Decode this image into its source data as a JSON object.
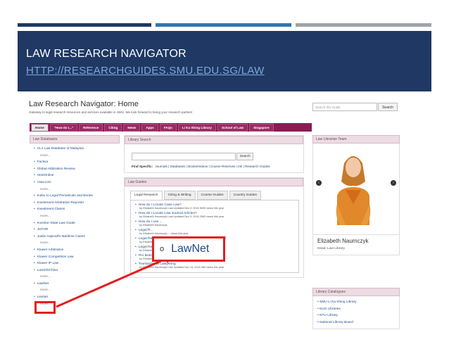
{
  "slide": {
    "title": "LAW RESEARCH NAVIGATOR",
    "url": "HTTP://RESEARCHGUIDES.SMU.EDU.SG/LAW"
  },
  "page": {
    "title": "Law Research Navigator: Home",
    "subtitle": "Gateway to legal research resources and services available in SMU. We look forward to being your research partner!",
    "search_placeholder": "Search this Guide",
    "search_button": "Search"
  },
  "nav": [
    {
      "label": "Home"
    },
    {
      "label": "\"How do I...\""
    },
    {
      "label": "Reference"
    },
    {
      "label": "Citing"
    },
    {
      "label": "News"
    },
    {
      "label": "Apps"
    },
    {
      "label": "FAQs"
    },
    {
      "label": "Li Ka Shing Library"
    },
    {
      "label": "School of Law"
    },
    {
      "label": "Singapore"
    }
  ],
  "law_databases": {
    "heading": "Law Databases",
    "items": [
      {
        "label": "CLJ Law Database of Malaysia"
      },
      {
        "label": "more...",
        "more": true
      },
      {
        "label": "Factiva"
      },
      {
        "label": "Global Arbitration Review"
      },
      {
        "label": "HeinOnline"
      },
      {
        "label": "i-law.com"
      },
      {
        "label": "more...",
        "more": true
      },
      {
        "label": "Index to Legal Periodicals and Books"
      },
      {
        "label": "Investment Arbitration Reporter"
      },
      {
        "label": "Investment Claims"
      },
      {
        "label": "more...",
        "more": true
      },
      {
        "label": "Investor-State Law Guide"
      },
      {
        "label": "JSTOR"
      },
      {
        "label": "Justis Aspinall's Maritime Cases"
      },
      {
        "label": "more...",
        "more": true
      },
      {
        "label": "Kluwer Arbitration"
      },
      {
        "label": "Kluwer Competition Law"
      },
      {
        "label": "Kluwer IP Law"
      },
      {
        "label": "LawInfoChina"
      },
      {
        "label": "more...",
        "more": true
      },
      {
        "label": "LawNet"
      },
      {
        "label": "more...",
        "more": true
      },
      {
        "label": "LexNet"
      },
      {
        "label": "more...",
        "more": true
      }
    ]
  },
  "library_search": {
    "heading": "Library Search",
    "button": "Search",
    "find_label": "Find Specific:",
    "find_links": "Journals | Databases | Books/Videos | Course Reserves | Ink | Research Guides"
  },
  "law_guides": {
    "heading": "Law Guides",
    "tabs": [
      {
        "label": "Legal Research"
      },
      {
        "label": "Citing & Writing"
      },
      {
        "label": "Course Guides"
      },
      {
        "label": "Country Guides"
      }
    ],
    "guides": [
      {
        "title": "How do I Locate Case Law?",
        "meta": "by Elizabeth Naumczyk   Last Updated Dec 9, 2016   5639 views this year"
      },
      {
        "title": "How do I Locate Law Journal Articles?",
        "meta": "by Elizabeth Naumczyk   Last Updated Dec 9, 2016   2963 views this year"
      },
      {
        "title": "How do I use ...",
        "meta": "by Elizabeth Naumczyk"
      },
      {
        "title": "Legal R...",
        "meta": "by Elizabeth Naumczyk   ... views this year"
      },
      {
        "title": "Legal Research 101: Skills for my first week of law school",
        "meta": "by Elizabeth Naumczyk   Last Updated Dec 12, 2016   3639 views this year"
      },
      {
        "title": "Legal Research & Writing (LAW 106)",
        "meta": "by Elizabeth Naumczyk   Last Updated Dec 9, 2016   2154 views this year"
      },
      {
        "title": "Pro Bono Resources",
        "meta": "by Elizabeth Naumczyk   Last Updated Dec 9, 2016   91 views this year"
      },
      {
        "title": "Transactional Lawyering",
        "meta": "by Elizabeth Naumczyk   Last Updated Nov 14, 2016   465 views this year"
      }
    ]
  },
  "librarian": {
    "heading": "Law Librarian Team",
    "name": "Elizabeth Naumczyk",
    "role": "Head, Law Library"
  },
  "catalogues": {
    "heading": "Library Catalogues",
    "items": [
      {
        "label": "SMU Li Ka Shing Library"
      },
      {
        "label": "NUS Libraries"
      },
      {
        "label": "NTU Library"
      },
      {
        "label": "National Library Board"
      }
    ]
  },
  "callout": {
    "bullet": "o",
    "text": "LawNet"
  },
  "colors": {
    "band": "#1f3864",
    "nav": "#8b1a53",
    "highlight": "#e02020",
    "link": "#1a4a8a"
  }
}
